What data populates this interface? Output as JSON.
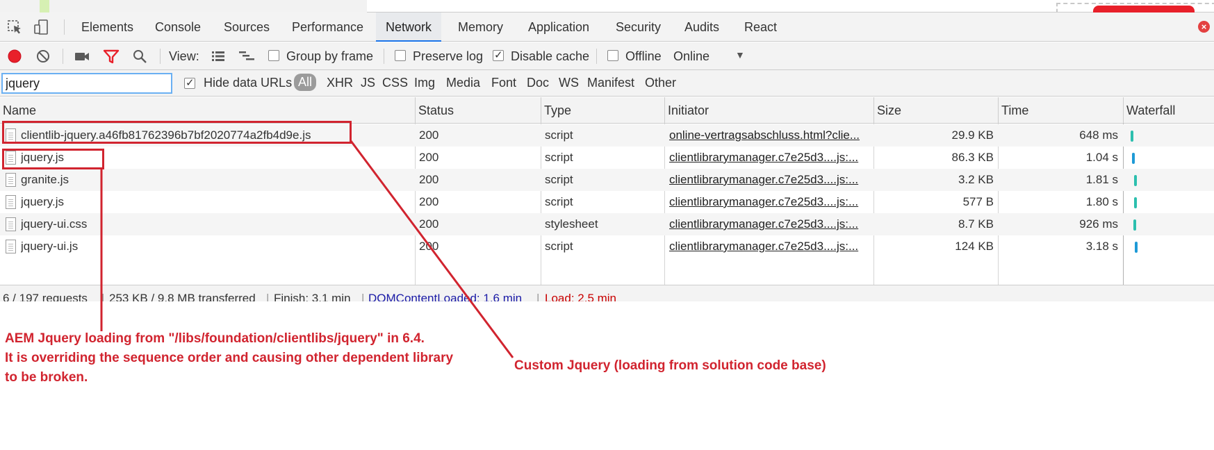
{
  "devtools": {
    "tabs": [
      "Elements",
      "Console",
      "Sources",
      "Performance",
      "Network",
      "Memory",
      "Application",
      "Security",
      "Audits",
      "React"
    ],
    "active_tab": "Network"
  },
  "toolbar": {
    "view_label": "View:",
    "group_by_frame": "Group by frame",
    "preserve_log": "Preserve log",
    "disable_cache": "Disable cache",
    "offline": "Offline",
    "throttle": "Online",
    "checks": {
      "group_by_frame": false,
      "preserve_log": false,
      "disable_cache": true,
      "offline": false
    },
    "record_color": "#e8202a",
    "filter_icon_color": "#e8202a"
  },
  "filter": {
    "value": "jquery",
    "hide_data_urls": "Hide data URLs",
    "types": [
      "All",
      "XHR",
      "JS",
      "CSS",
      "Img",
      "Media",
      "Font",
      "Doc",
      "WS",
      "Manifest",
      "Other"
    ],
    "active_type": "All"
  },
  "table": {
    "columns": [
      "Name",
      "Status",
      "Type",
      "Initiator",
      "Size",
      "Time",
      "Waterfall"
    ],
    "rows": [
      {
        "name": "clientlib-jquery.a46fb81762396b7bf2020774a2fb4d9e.js",
        "status": "200",
        "type": "script",
        "initiator": "online-vertragsabschluss.html?clie...",
        "size": "29.9 KB",
        "time": "648 ms"
      },
      {
        "name": "jquery.js",
        "status": "200",
        "type": "script",
        "initiator": "clientlibrarymanager.c7e25d3....js:...",
        "size": "86.3 KB",
        "time": "1.04 s"
      },
      {
        "name": "granite.js",
        "status": "200",
        "type": "script",
        "initiator": "clientlibrarymanager.c7e25d3....js:...",
        "size": "3.2 KB",
        "time": "1.81 s"
      },
      {
        "name": "jquery.js",
        "status": "200",
        "type": "script",
        "initiator": "clientlibrarymanager.c7e25d3....js:...",
        "size": "577 B",
        "time": "1.80 s"
      },
      {
        "name": "jquery-ui.css",
        "status": "200",
        "type": "stylesheet",
        "initiator": "clientlibrarymanager.c7e25d3....js:...",
        "size": "8.7 KB",
        "time": "926 ms"
      },
      {
        "name": "jquery-ui.js",
        "status": "200",
        "type": "script",
        "initiator": "clientlibrarymanager.c7e25d3....js:...",
        "size": "124 KB",
        "time": "3.18 s"
      }
    ]
  },
  "statusbar": {
    "requests": "6 / 197 requests",
    "transferred": "253 KB / 9.8 MB transferred",
    "finish": "Finish: 3.1 min",
    "dom_content_loaded": "DOMContentLoaded: 1.6 min",
    "load": "Load: 2.5 min"
  },
  "annotations": {
    "left_line1": "AEM Jquery loading from \"/libs/foundation/clientlibs/jquery\" in 6.4.",
    "left_line2": "It is overriding the sequence order and causing other dependent library",
    "left_line3": "to be broken.",
    "right": "Custom Jquery (loading from solution code base)",
    "color": "#d1242f"
  }
}
